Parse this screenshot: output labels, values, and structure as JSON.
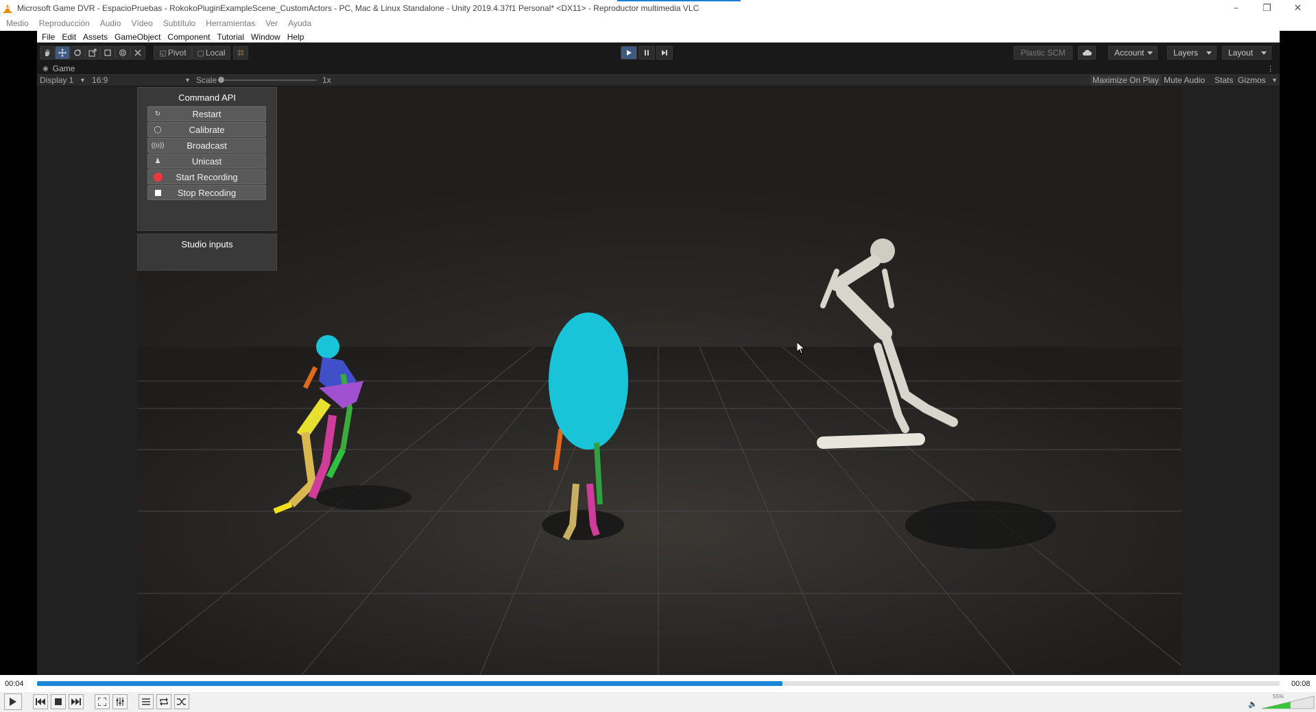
{
  "vlc": {
    "window_title": "Microsoft Game DVR - EspacioPruebas - RokokoPluginExampleScene_CustomActors - PC, Mac & Linux Standalone - Unity 2019.4.37f1 Personal* <DX11> - Reproductor multimedia VLC",
    "menu": [
      "Medio",
      "Reproducción",
      "Audio",
      "Vídeo",
      "Subtítulo",
      "Herramientas",
      "Ver",
      "Ayuda"
    ],
    "time_current": "00:04",
    "time_total": "00:08",
    "progress_fraction": 0.6,
    "volume_label": "55%",
    "volume_fraction": 0.55
  },
  "unity": {
    "menu": [
      "File",
      "Edit",
      "Assets",
      "GameObject",
      "Component",
      "Tutorial",
      "Window",
      "Help"
    ],
    "toolbar": {
      "pivot_label": "Pivot",
      "local_label": "Local",
      "plastic_label": "Plastic SCM",
      "account_label": "Account",
      "layers_label": "Layers",
      "layout_label": "Layout"
    },
    "game_tab_label": "Game",
    "gamebar": {
      "display_label": "Display 1",
      "aspect_label": "16:9",
      "scale_label": "Scale",
      "scale_value": "1x",
      "maximize_label": "Maximize On Play",
      "mute_label": "Mute Audio",
      "stats_label": "Stats",
      "gizmos_label": "Gizmos"
    },
    "command_panel": {
      "title": "Command API",
      "buttons": [
        {
          "label": "Restart",
          "icon": "restart-icon"
        },
        {
          "label": "Calibrate",
          "icon": "calibrate-icon"
        },
        {
          "label": "Broadcast",
          "icon": "broadcast-icon"
        },
        {
          "label": "Unicast",
          "icon": "unicast-icon"
        },
        {
          "label": "Start Recording",
          "icon": "record-icon"
        },
        {
          "label": "Stop Recoding",
          "icon": "stop-icon"
        }
      ]
    },
    "studio_panel": {
      "title": "Studio inputs"
    }
  },
  "colors": {
    "record_red": "#e8393c",
    "seek_blue": "#1a86d8",
    "actor_cyan": "#1ac4d8",
    "actor_white": "#d8d6cc"
  }
}
